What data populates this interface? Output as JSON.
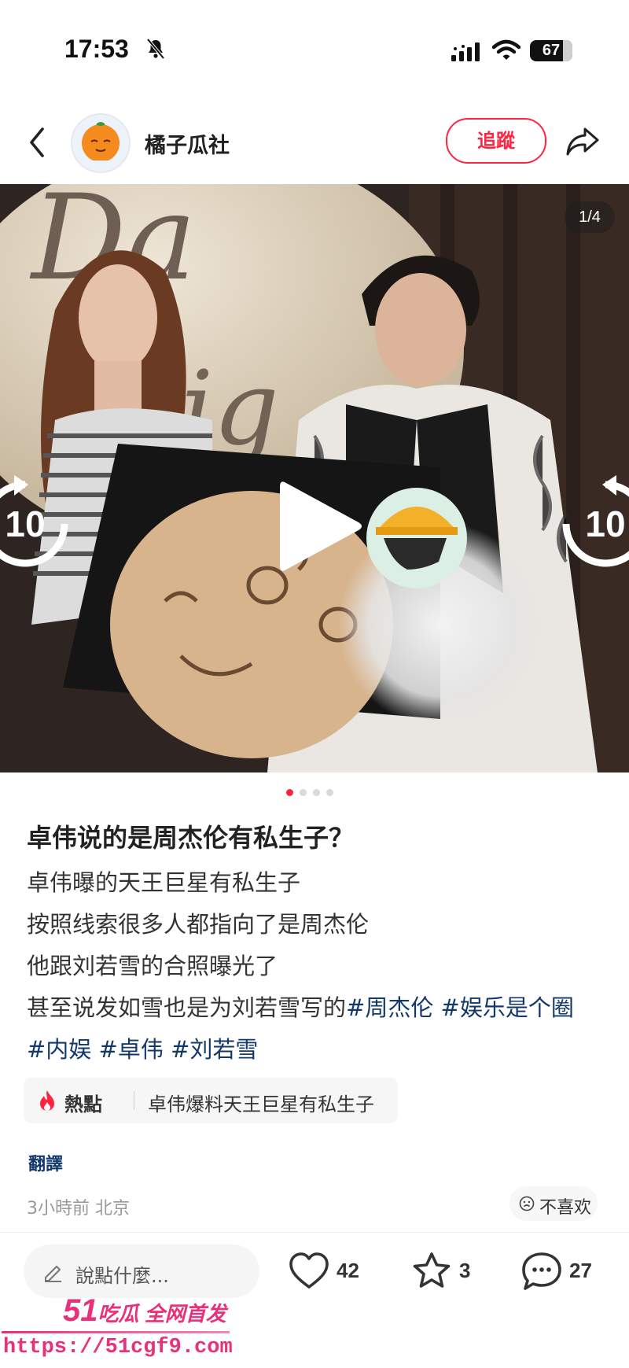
{
  "status_bar": {
    "time": "17:53",
    "battery": "67",
    "icons": [
      "bell-slash-icon",
      "signal-icon",
      "wifi-icon",
      "battery-icon"
    ]
  },
  "header": {
    "author_name": "橘子瓜社",
    "follow_label": "追蹤",
    "icons": [
      "back-chevron-icon",
      "share-icon"
    ]
  },
  "media": {
    "counter": "1/4",
    "skip_back": "10",
    "skip_forward": "10",
    "icons": [
      "play-icon",
      "replay-10-icon",
      "forward-10-icon"
    ],
    "dots_total": 4,
    "dots_active": 1
  },
  "post": {
    "title": "卓伟说的是周杰伦有私生子？",
    "lines": [
      "卓伟曝的天王巨星有私生子",
      "按照线索很多人都指向了是周杰伦",
      "他跟刘若雪的合照曝光了",
      "甚至说发如雪也是为刘若雪写的"
    ],
    "tags": [
      "#周杰伦",
      "#娱乐是个圈",
      "#内娱",
      "#卓伟",
      "#刘若雪"
    ]
  },
  "hot_topic": {
    "label": "熱點",
    "topic": "卓伟爆料天王巨星有私生子"
  },
  "translate_label": "翻譯",
  "meta": "3小時前 北京",
  "dislike_label": "不喜欢",
  "bottom_bar": {
    "comment_placeholder": "說點什麼...",
    "likes": "42",
    "collects": "3",
    "comments": "27"
  },
  "watermark": {
    "number": "51",
    "text": "吃瓜 全网首发",
    "url": "https://51cgf9.com"
  },
  "colors": {
    "accent": "#ff2442",
    "tag": "#13386c",
    "watermark": "#e8317a"
  }
}
